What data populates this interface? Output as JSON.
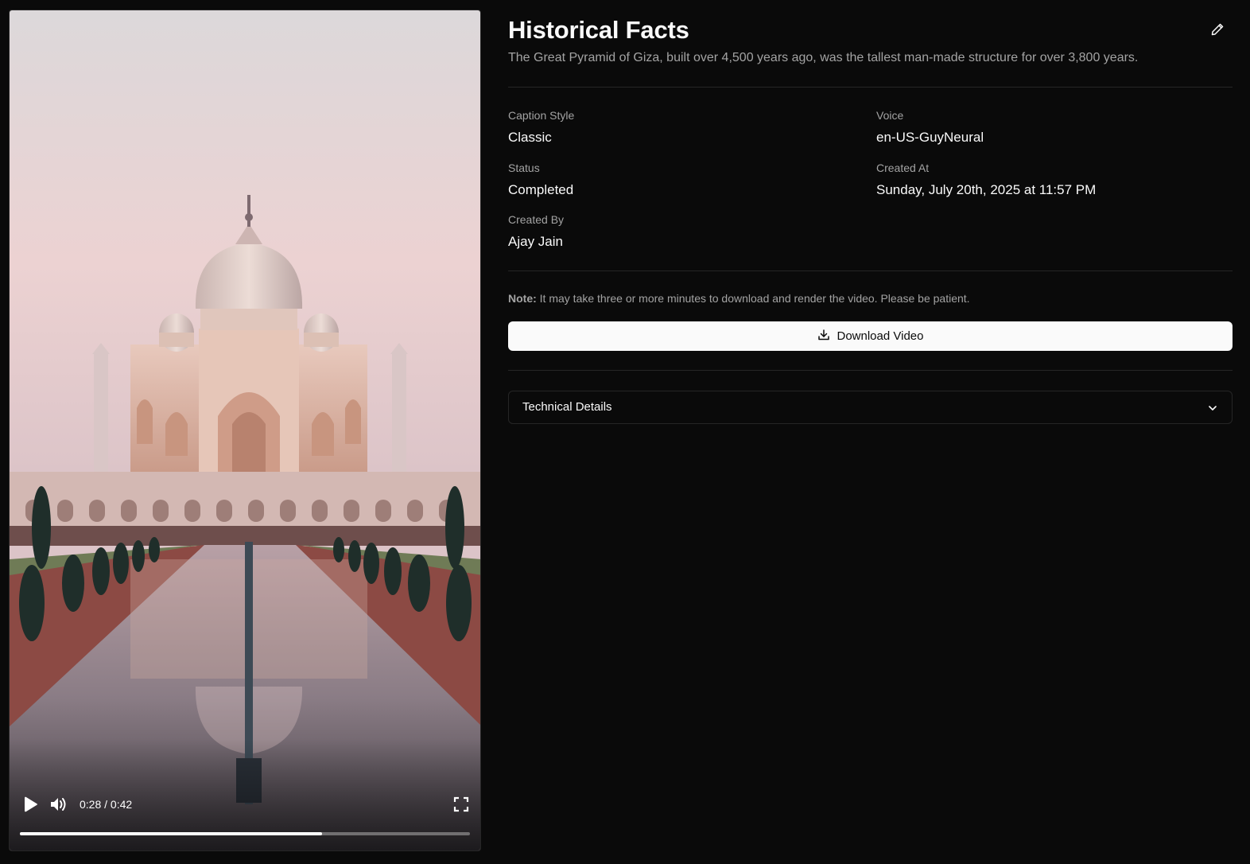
{
  "video": {
    "time_display": "0:28 / 0:42",
    "progress_fraction": 0.672,
    "icons": {
      "play": "play-icon",
      "volume": "volume-icon",
      "fullscreen": "fullscreen-icon"
    }
  },
  "header": {
    "title": "Historical Facts",
    "description": "The Great Pyramid of Giza, built over 4,500 years ago, was the tallest man-made structure for over 3,800 years.",
    "edit_icon": "pencil-icon"
  },
  "fields": {
    "caption_style": {
      "label": "Caption Style",
      "value": "Classic"
    },
    "voice": {
      "label": "Voice",
      "value": "en-US-GuyNeural"
    },
    "status": {
      "label": "Status",
      "value": "Completed"
    },
    "created_at": {
      "label": "Created At",
      "value": "Sunday, July 20th, 2025 at 11:57 PM"
    },
    "created_by": {
      "label": "Created By",
      "value": "Ajay Jain"
    }
  },
  "note": {
    "prefix": "Note:",
    "text": " It may take three or more minutes to download and render the video. Please be patient."
  },
  "download": {
    "label": "Download Video",
    "icon": "download-icon"
  },
  "technical": {
    "label": "Technical Details",
    "icon": "chevron-down-icon"
  },
  "colors": {
    "background": "#0a0a0a",
    "border": "#262626",
    "muted_text": "#a3a3a3",
    "button_bg": "#fafafa"
  }
}
